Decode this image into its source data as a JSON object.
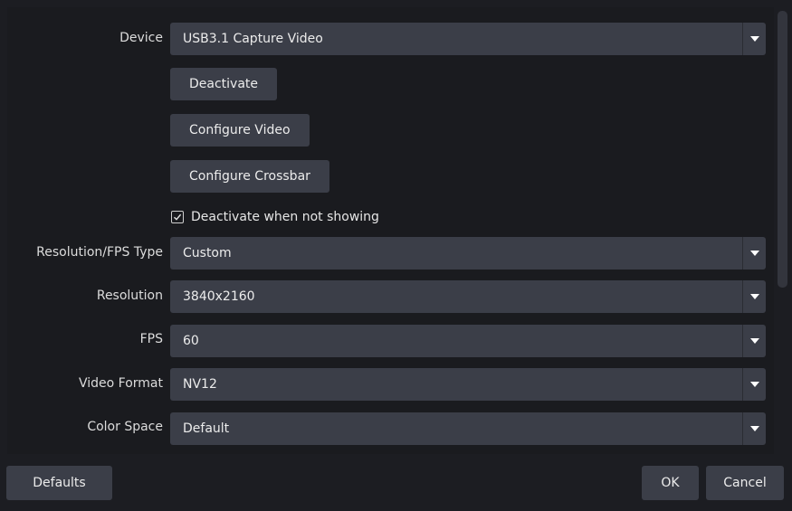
{
  "device": {
    "label": "Device",
    "value": "USB3.1 Capture Video"
  },
  "buttons": {
    "deactivate": "Deactivate",
    "configure_video": "Configure Video",
    "configure_crossbar": "Configure Crossbar"
  },
  "checkbox": {
    "label": "Deactivate when not showing",
    "checked": true
  },
  "fields": [
    {
      "label": "Resolution/FPS Type",
      "value": "Custom"
    },
    {
      "label": "Resolution",
      "value": "3840x2160"
    },
    {
      "label": "FPS",
      "value": "60"
    },
    {
      "label": "Video Format",
      "value": "NV12"
    },
    {
      "label": "Color Space",
      "value": "Default"
    }
  ],
  "footer": {
    "defaults": "Defaults",
    "ok": "OK",
    "cancel": "Cancel"
  },
  "icons": {
    "dropdown": "chevron-down-icon",
    "check": "check-icon"
  },
  "colors": {
    "background": "#1a1b1f",
    "control": "#3b3e48",
    "text": "#ececec"
  }
}
